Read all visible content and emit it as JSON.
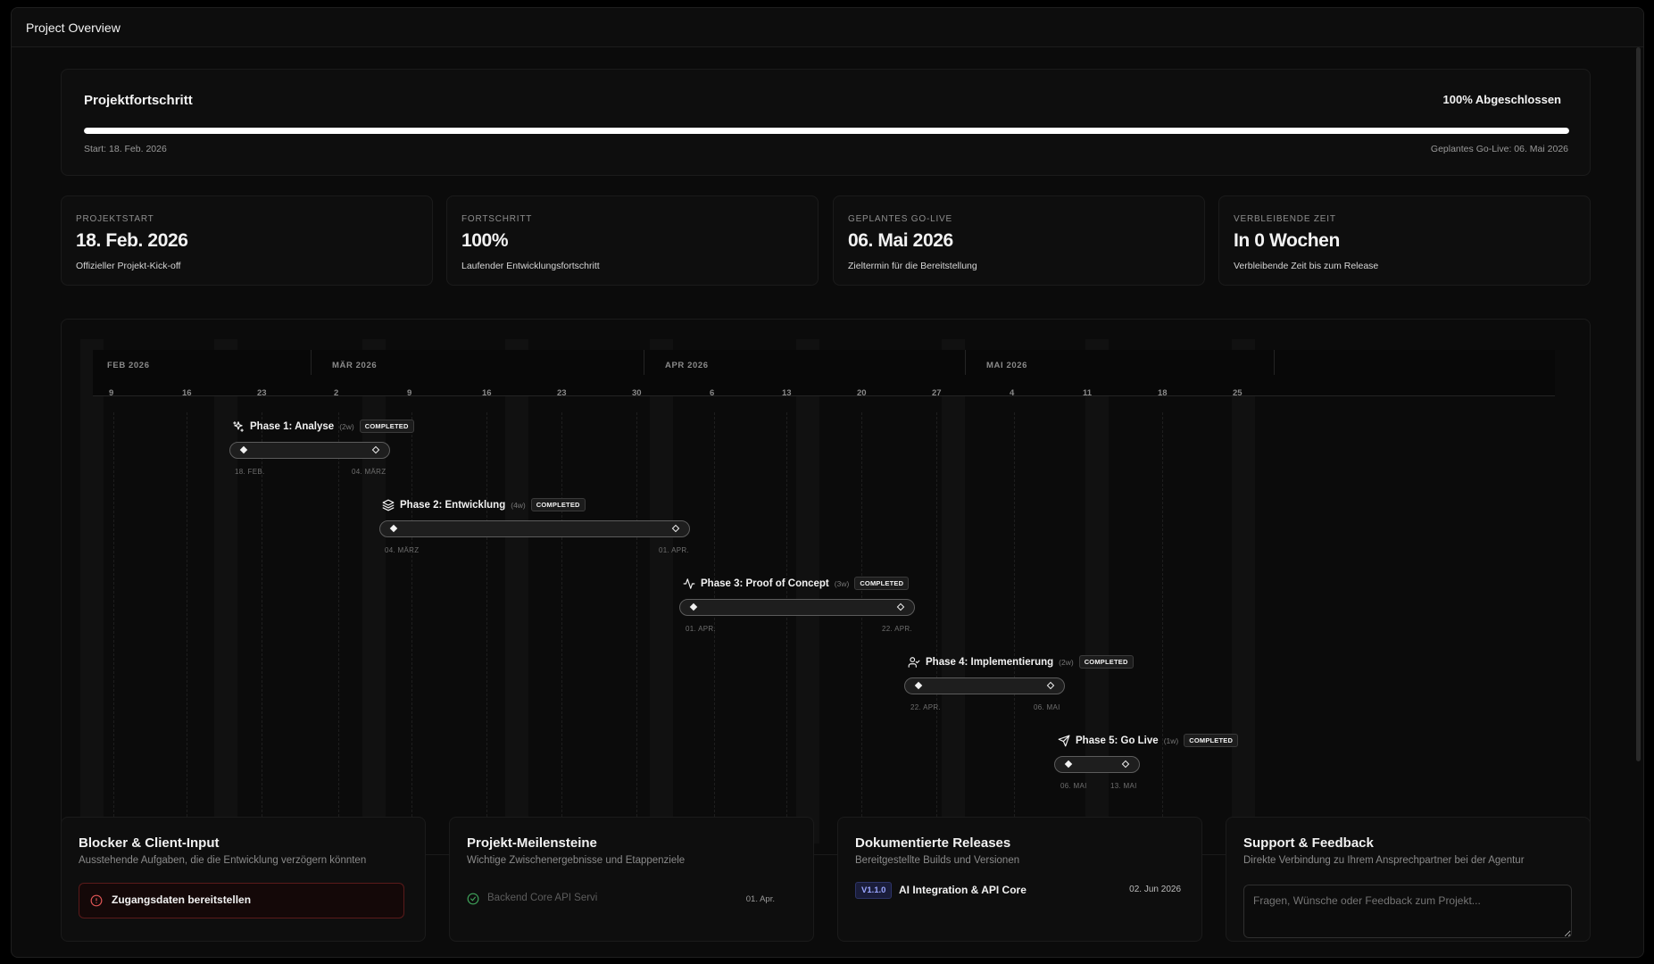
{
  "window": {
    "title": "Project Overview"
  },
  "progress": {
    "title": "Projektfortschritt",
    "percent_label": "100% Abgeschlossen",
    "percent": 100,
    "start_label": "Start: 18. Feb. 2026",
    "golive_label": "Geplantes Go-Live: 06. Mai 2026"
  },
  "stats": [
    {
      "label": "PROJEKTSTART",
      "value": "18. Feb. 2026",
      "desc": "Offizieller Projekt-Kick-off"
    },
    {
      "label": "FORTSCHRITT",
      "value": "100%",
      "desc": "Laufender Entwicklungsfortschritt"
    },
    {
      "label": "GEPLANTES GO-LIVE",
      "value": "06. Mai 2026",
      "desc": "Zieltermin für die Bereitstellung"
    },
    {
      "label": "VERBLEIBENDE ZEIT",
      "value": "In 0 Wochen",
      "desc": "Verbleibende Zeit bis zum Release"
    }
  ],
  "gantt": {
    "months": [
      "FEB 2026",
      "MÄR 2026",
      "APR 2026",
      "MAI 2026"
    ],
    "weeks": [
      "9",
      "16",
      "23",
      "2",
      "9",
      "16",
      "23",
      "30",
      "6",
      "13",
      "20",
      "27",
      "4",
      "11",
      "18",
      "25"
    ],
    "phases": [
      {
        "icon": "sparkles-icon",
        "name": "Phase 1: Analyse",
        "duration": "(2w)",
        "status": "COMPLETED",
        "start": "18. FEB.",
        "end": "04. MÄRZ"
      },
      {
        "icon": "layers-icon",
        "name": "Phase 2: Entwicklung",
        "duration": "(4w)",
        "status": "COMPLETED",
        "start": "04. MÄRZ",
        "end": "01. APR."
      },
      {
        "icon": "activity-icon",
        "name": "Phase 3: Proof of Concept",
        "duration": "(3w)",
        "status": "COMPLETED",
        "start": "01. APR.",
        "end": "22. APR."
      },
      {
        "icon": "user-check-icon",
        "name": "Phase 4: Implementierung",
        "duration": "(2w)",
        "status": "COMPLETED",
        "start": "22. APR.",
        "end": "06. MAI"
      },
      {
        "icon": "send-icon",
        "name": "Phase 5: Go Live",
        "duration": "(1w)",
        "status": "COMPLETED",
        "start": "06. MAI",
        "end": "13. MAI"
      }
    ]
  },
  "blockers": {
    "title": "Blocker & Client-Input",
    "subtitle": "Ausstehende Aufgaben, die die Entwicklung verzögern könnten",
    "items": [
      {
        "label": "Zugangsdaten bereitstellen",
        "icon": "alert-circle-icon"
      }
    ]
  },
  "milestones": {
    "title": "Projekt-Meilensteine",
    "subtitle": "Wichtige Zwischenergebnisse und Etappenziele",
    "items": [
      {
        "label": "Backend Core API Servi",
        "date": "01. Apr.",
        "icon": "check-circle-icon"
      }
    ]
  },
  "releases": {
    "title": "Dokumentierte Releases",
    "subtitle": "Bereitgestellte Builds und Versionen",
    "items": [
      {
        "version": "V1.1.0",
        "title": "AI Integration & API Core",
        "date": "02. Jun 2026"
      }
    ]
  },
  "support": {
    "title": "Support & Feedback",
    "subtitle": "Direkte Verbindung zu Ihrem Ansprechpartner bei der Agentur",
    "placeholder": "Fragen, Wünsche oder Feedback zum Projekt..."
  },
  "colors": {
    "accent": "#ffffff",
    "danger": "#5a1a1a",
    "version_badge": "#9aa6ff"
  }
}
